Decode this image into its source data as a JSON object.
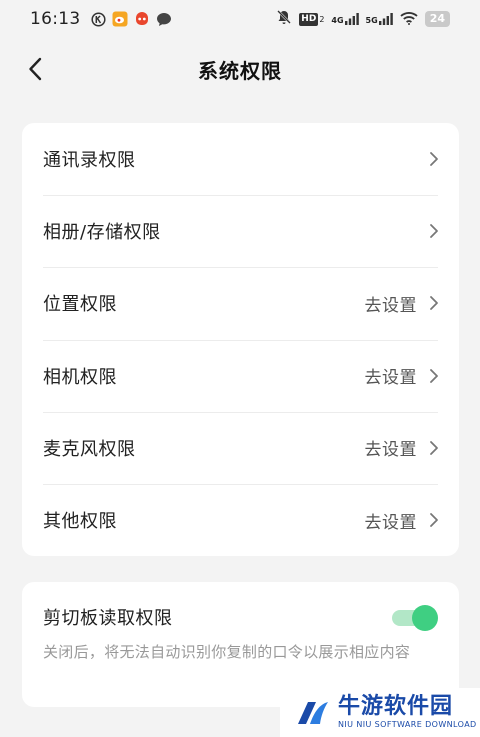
{
  "status": {
    "time": "16:13",
    "hd_label": "HD",
    "net_4g": "4G",
    "net_5g": "5G",
    "battery": "24"
  },
  "header": {
    "title": "系统权限"
  },
  "permissions": [
    {
      "label": "通讯录权限",
      "value": ""
    },
    {
      "label": "相册/存储权限",
      "value": ""
    },
    {
      "label": "位置权限",
      "value": "去设置"
    },
    {
      "label": "相机权限",
      "value": "去设置"
    },
    {
      "label": "麦克风权限",
      "value": "去设置"
    },
    {
      "label": "其他权限",
      "value": "去设置"
    }
  ],
  "clipboard": {
    "label": "剪切板读取权限",
    "enabled": true,
    "description": "关闭后，将无法自动识别你复制的口令以展示相应内容"
  },
  "watermark": {
    "cn": "牛游软件园",
    "en": "NIU NIU SOFTWARE DOWNLOAD"
  },
  "colors": {
    "accent": "#3fcf82",
    "accent_track": "#b2e7c7",
    "background": "#f3f3f3",
    "watermark": "#1a4aa8"
  }
}
